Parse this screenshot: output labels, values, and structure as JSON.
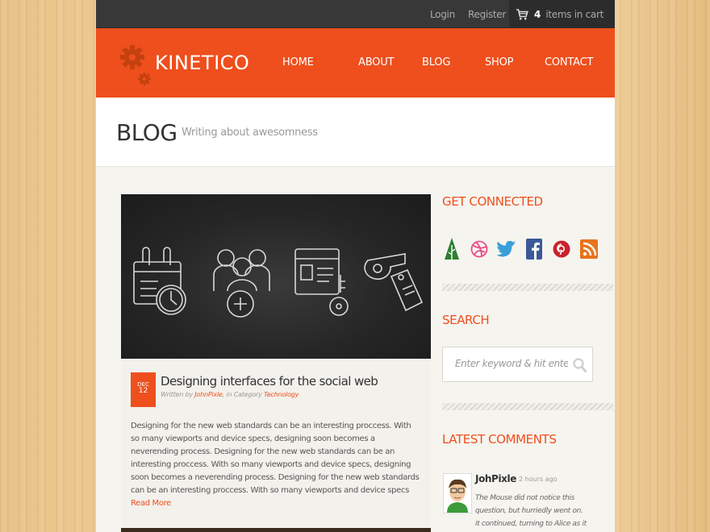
{
  "topbar": {
    "login": "Login",
    "register": "Register",
    "cart_count": "4",
    "cart_label": "items in cart"
  },
  "header": {
    "logo": "KINETICO",
    "nav": [
      "HOME",
      "ABOUT",
      "BLOG",
      "SHOP",
      "CONTACT"
    ]
  },
  "page_title": {
    "title": "BLOG",
    "subtitle": "Writing about awesomness"
  },
  "post": {
    "date_month": "DEC",
    "date_day": "12",
    "title": "Designing interfaces for the social web",
    "meta_prefix": "Written by ",
    "author": "JohnPixle",
    "meta_mid": ", in Category ",
    "category": "Technology",
    "body": "Designing for the new web standards can be an interesting proccess. With so many viewports and device specs, designing soon becomes a neverending process. Designing for the new web standards can be an interesting proccess. With so many viewports and device specs, designing soon becomes a neverending process. Designing for the new web standards can be an interesting proccess. With so many viewports and device specs ",
    "read_more": "Read More",
    "image_icons": [
      "calendar-clock-icon",
      "team-add-icon",
      "id-card-key-icon",
      "whistle-tag-icon"
    ]
  },
  "sidebar": {
    "connected_title": "GET CONNECTED",
    "social_icons": [
      "forrst-icon",
      "dribbble-icon",
      "twitter-icon",
      "facebook-icon",
      "pinterest-icon",
      "rss-icon"
    ],
    "search_title": "SEARCH",
    "search_placeholder": "Enter keyword & hit enter",
    "comments_title": "LATEST COMMENTS",
    "comment": {
      "name": "JohPixle",
      "time": "2 hours ago",
      "text": "The Mouse did not notice this question, but hurriedly went on. it continued, turning to Alice as it spoke."
    }
  },
  "colors": {
    "accent": "#ee4f1d",
    "topbar": "#383838",
    "page_bg": "#f6f4ef"
  }
}
